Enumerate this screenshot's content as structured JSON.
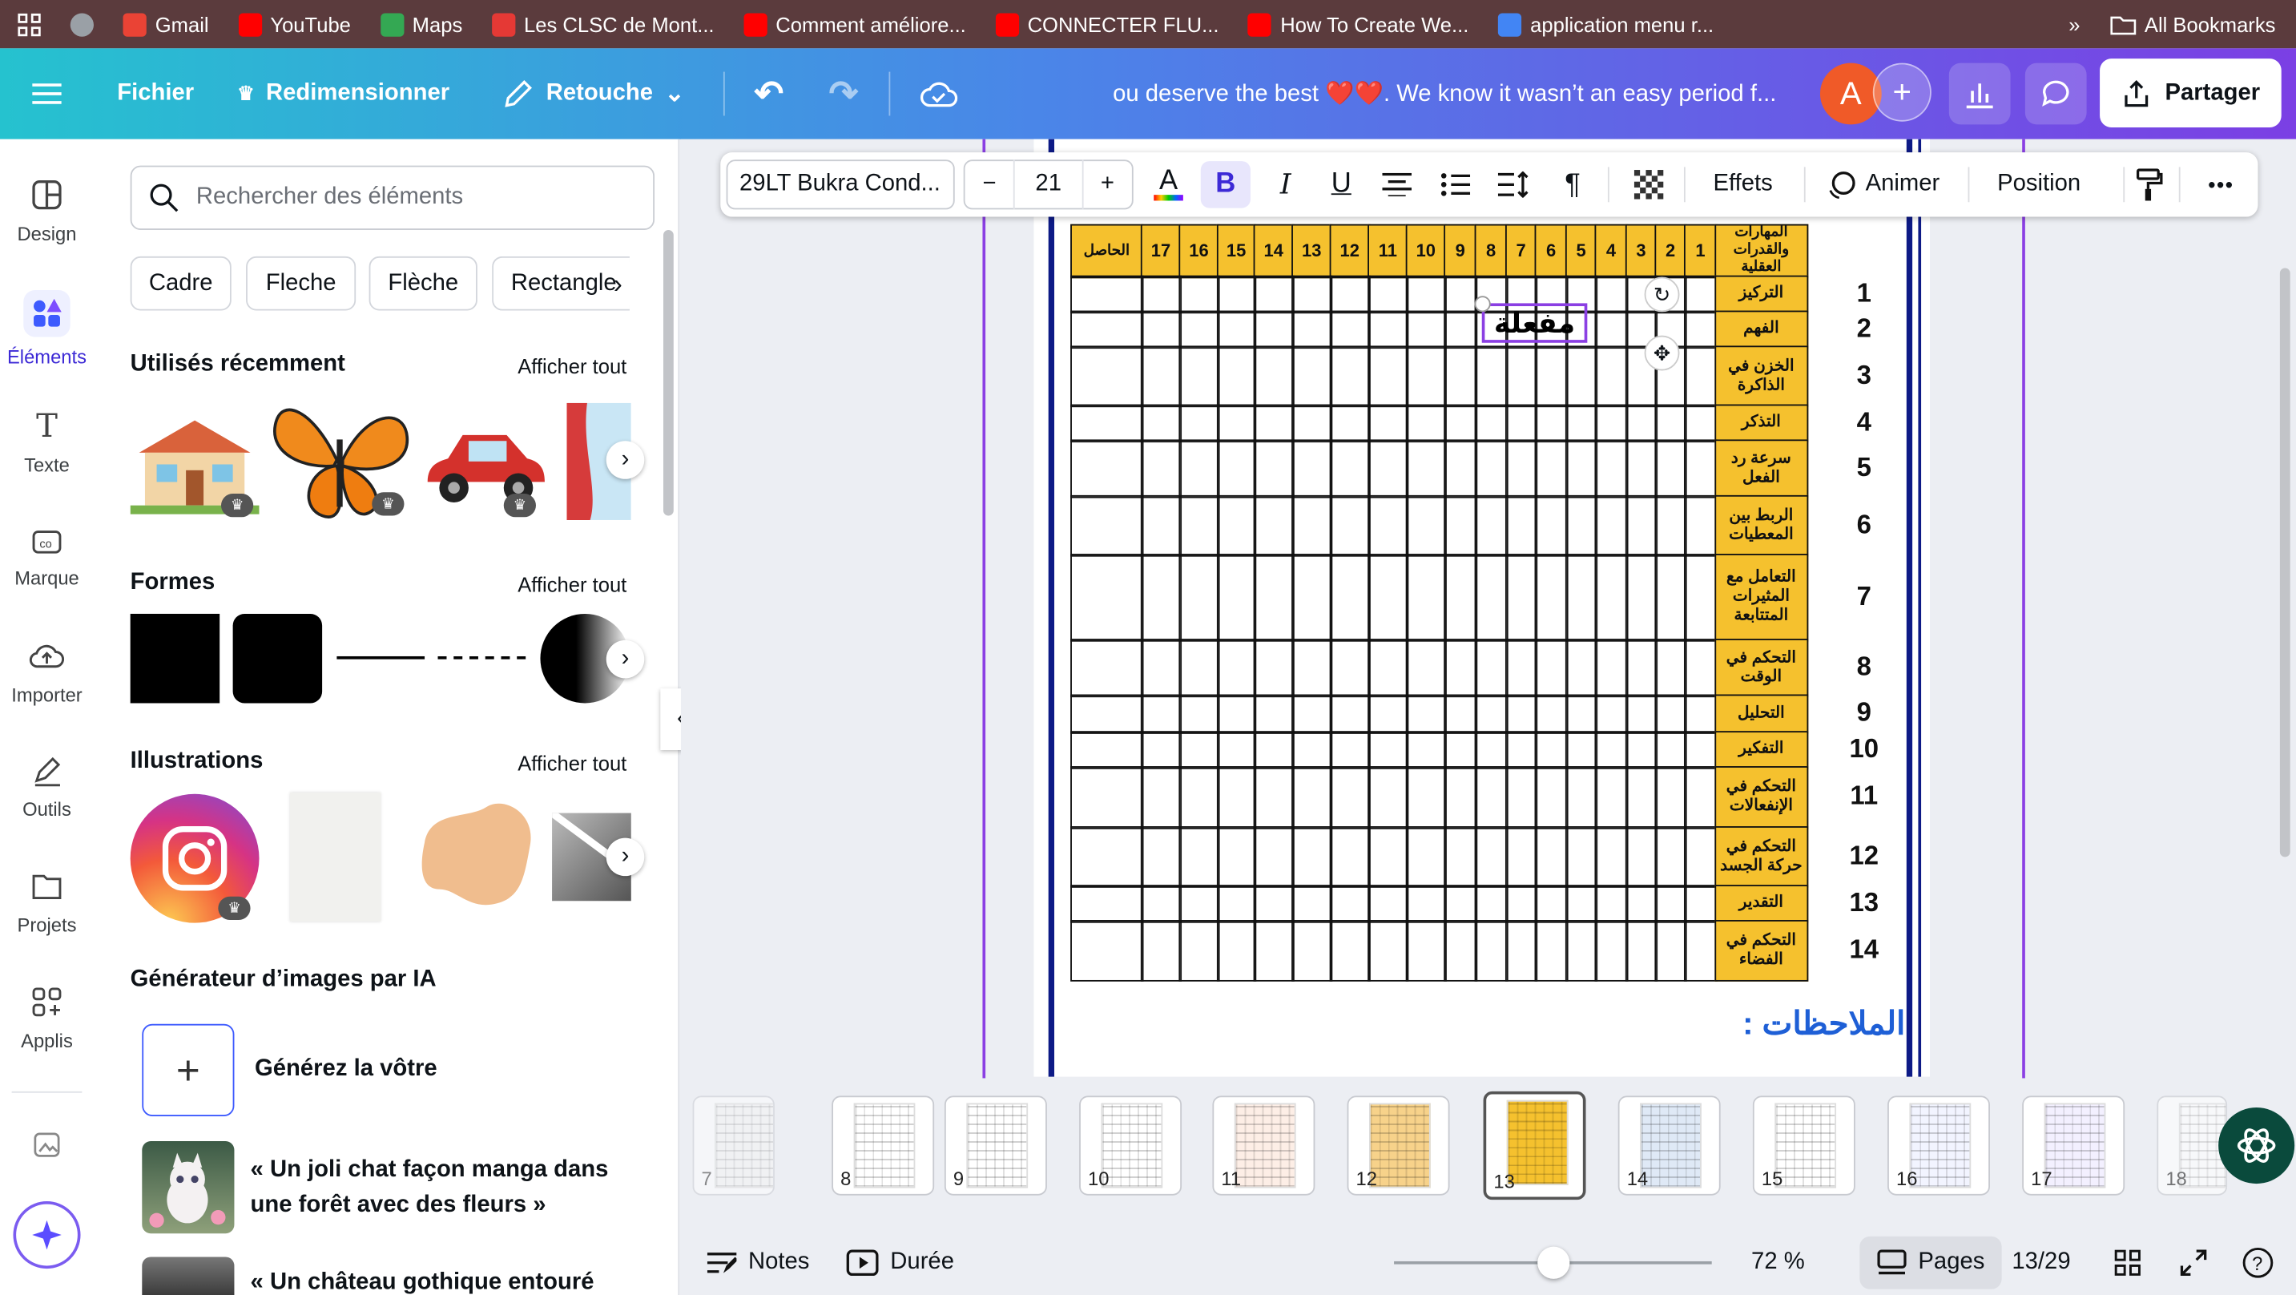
{
  "bookmarks": [
    {
      "label": "",
      "color": "#9aa0a6"
    },
    {
      "label": "Gmail",
      "color": "#ea4335"
    },
    {
      "label": "YouTube",
      "color": "#ff0000"
    },
    {
      "label": "Maps",
      "color": "#34a853"
    },
    {
      "label": "Les CLSC de Mont...",
      "color": "#e53935"
    },
    {
      "label": "Comment améliore...",
      "color": "#ff0000"
    },
    {
      "label": "CONNECTER FLU...",
      "color": "#ff0000"
    },
    {
      "label": "How To Create We...",
      "color": "#ff0000"
    },
    {
      "label": "application menu r...",
      "color": "#4285f4"
    }
  ],
  "all_bookmarks": "All Bookmarks",
  "top": {
    "file": "Fichier",
    "resize": "Redimensionner",
    "edit": "Retouche",
    "title": "ou deserve the best ❤️❤️. We know it wasn’t an easy period f...",
    "avatar": "A",
    "share": "Partager"
  },
  "rail": [
    {
      "label": "Design",
      "icon": "design-icon"
    },
    {
      "label": "Éléments",
      "icon": "elements-icon"
    },
    {
      "label": "Texte",
      "icon": "text-icon"
    },
    {
      "label": "Marque",
      "icon": "brand-icon"
    },
    {
      "label": "Importer",
      "icon": "upload-icon"
    },
    {
      "label": "Outils",
      "icon": "tools-icon"
    },
    {
      "label": "Projets",
      "icon": "folder-icon"
    },
    {
      "label": "Applis",
      "icon": "apps-icon"
    }
  ],
  "panel": {
    "search_placeholder": "Rechercher des éléments",
    "chips": [
      "Cadre",
      "Fleche",
      "Flèche",
      "Rectangle"
    ],
    "recent": "Utilisés récemment",
    "shapes": "Formes",
    "illustrations": "Illustrations",
    "see_all": "Afficher tout",
    "ai_title": "Générateur d’images par IA",
    "ai_create": "Générez la vôtre",
    "ai_example1": "« Un joli chat façon manga dans une forêt avec des fleurs »",
    "ai_example2": "« Un château gothique entouré"
  },
  "toolbar": {
    "font": "29LT Bukra Cond...",
    "minus": "−",
    "size": "21",
    "plus": "+",
    "bold": "B",
    "italic": "I",
    "underline": "U",
    "effects": "Effets",
    "animate": "Animer",
    "position": "Position",
    "more": "•••"
  },
  "table": {
    "header_label": "المهارات والقدرات العقلية",
    "result": "الحاصل",
    "columns": [
      "1",
      "2",
      "3",
      "4",
      "5",
      "6",
      "7",
      "8",
      "9",
      "10",
      "11",
      "12",
      "13",
      "14",
      "15",
      "16",
      "17"
    ],
    "rows": [
      {
        "n": "1",
        "label": "التركيز"
      },
      {
        "n": "2",
        "label": "الفهم"
      },
      {
        "n": "3",
        "label": "الخزن في الذاكرة"
      },
      {
        "n": "4",
        "label": "التذكر"
      },
      {
        "n": "5",
        "label": "سرعة رد الفعل"
      },
      {
        "n": "6",
        "label": "الربط بين المعطيات"
      },
      {
        "n": "7",
        "label": "التعامل مع المثيرات المتتابعة"
      },
      {
        "n": "8",
        "label": "التحكم في الوقت"
      },
      {
        "n": "9",
        "label": "التحليل"
      },
      {
        "n": "10",
        "label": "التفكير"
      },
      {
        "n": "11",
        "label": "التحكم في الإنفعالات"
      },
      {
        "n": "12",
        "label": "التحكم في حركة الجسد"
      },
      {
        "n": "13",
        "label": "التقدير"
      },
      {
        "n": "14",
        "label": "التحكم في الفضاء"
      }
    ],
    "selected_text": "مفعلة",
    "notes": "الملاحظات :"
  },
  "pages": [
    "7",
    "8",
    "9",
    "10",
    "11",
    "12",
    "13",
    "14",
    "15",
    "16",
    "17",
    "18"
  ],
  "current_page": "13",
  "bottom": {
    "notes": "Notes",
    "duration": "Durée",
    "zoom": "72 %",
    "pages": "Pages",
    "count": "13/29"
  }
}
